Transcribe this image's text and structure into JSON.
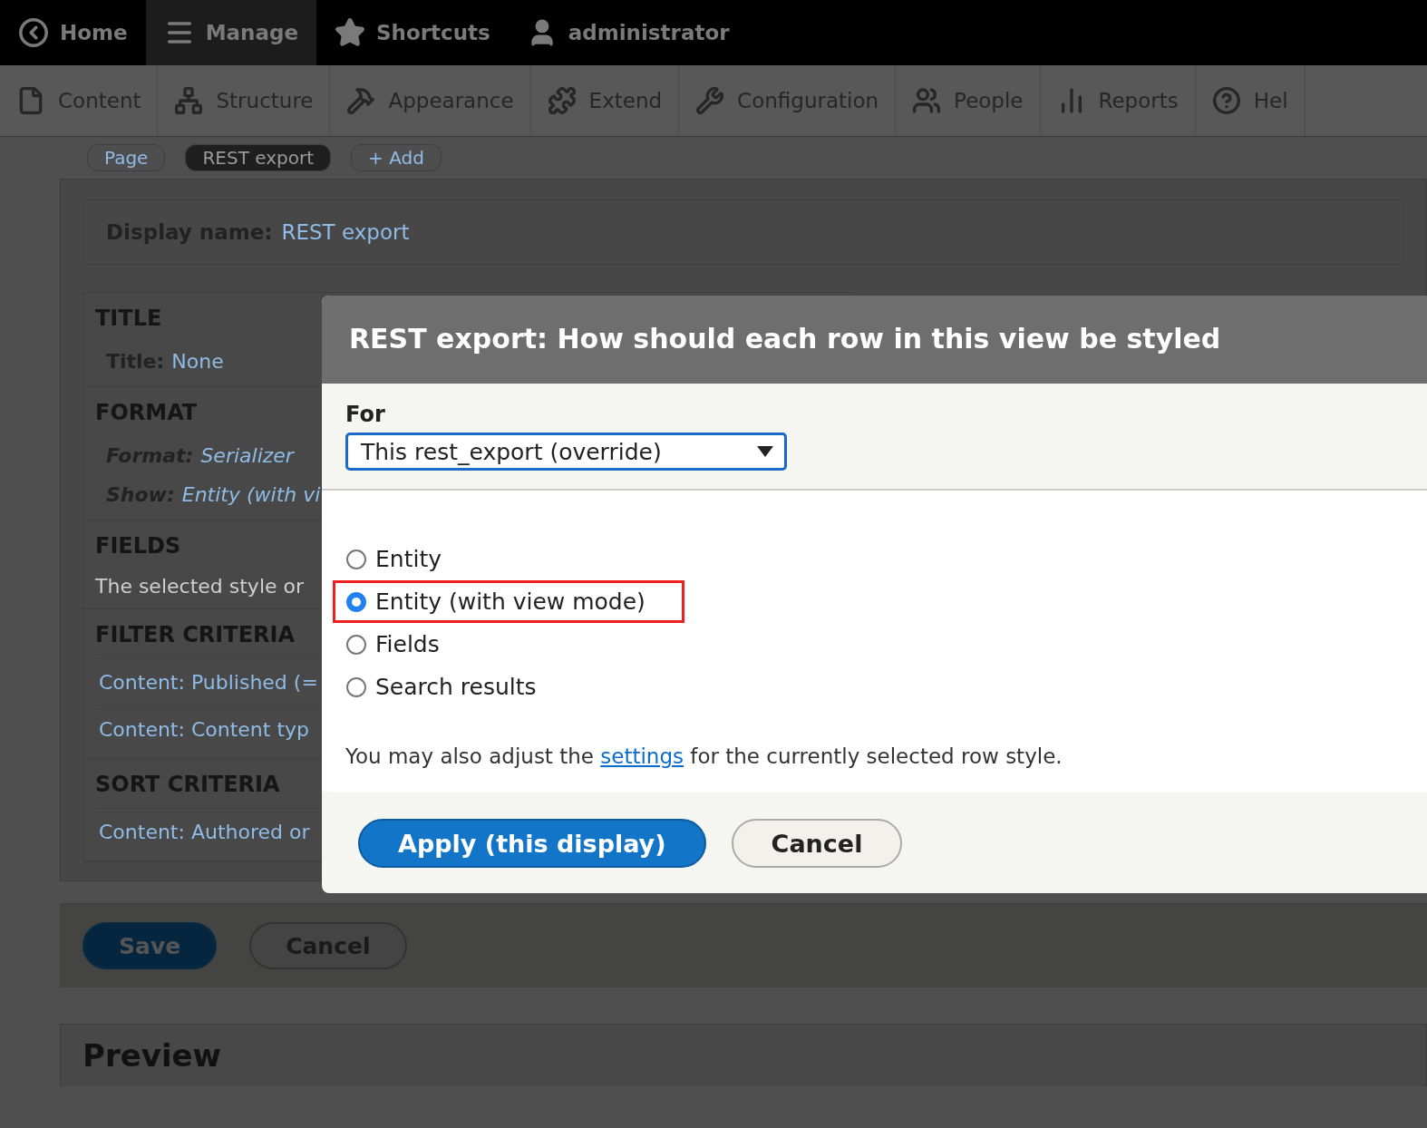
{
  "toolbar": {
    "items": [
      {
        "label": "Home",
        "selected": false
      },
      {
        "label": "Manage",
        "selected": true
      },
      {
        "label": "Shortcuts",
        "selected": false
      },
      {
        "label": "administrator",
        "selected": false
      }
    ]
  },
  "admin_menu": {
    "items": [
      {
        "label": "Content"
      },
      {
        "label": "Structure"
      },
      {
        "label": "Appearance"
      },
      {
        "label": "Extend"
      },
      {
        "label": "Configuration"
      },
      {
        "label": "People"
      },
      {
        "label": "Reports"
      },
      {
        "label": "Hel"
      }
    ]
  },
  "display_tabs": [
    {
      "label": "Page",
      "selected": false
    },
    {
      "label": "REST export",
      "selected": true
    },
    {
      "label": "+ Add",
      "selected": false
    }
  ],
  "display_name": {
    "label": "Display name:",
    "value": "REST export"
  },
  "sections": [
    {
      "heading": "TITLE",
      "rows": [
        {
          "kind": "pair",
          "label": "Title:",
          "value": "None"
        }
      ]
    },
    {
      "heading": "FORMAT",
      "rows": [
        {
          "kind": "italic_pair",
          "label": "Format:",
          "value": "Serializer"
        },
        {
          "kind": "italic_pair",
          "label": "Show:",
          "value": "Entity (with vi"
        }
      ]
    },
    {
      "heading": "FIELDS",
      "rows": [
        {
          "kind": "text",
          "text": "The selected style or"
        }
      ]
    },
    {
      "heading": "FILTER CRITERIA",
      "rows": [
        {
          "kind": "link",
          "text": "Content: Published (="
        },
        {
          "kind": "link",
          "text": "Content: Content typ"
        }
      ]
    },
    {
      "heading": "SORT CRITERIA",
      "rows": [
        {
          "kind": "link",
          "text": "Content: Authored or"
        }
      ]
    }
  ],
  "dialog": {
    "title": "REST export: How should each row in this view be styled",
    "for_label": "For",
    "for_value": "This rest_export (override)",
    "options": [
      {
        "label": "Entity",
        "selected": false,
        "highlighted": false
      },
      {
        "label": "Entity (with view mode)",
        "selected": true,
        "highlighted": true
      },
      {
        "label": "Fields",
        "selected": false,
        "highlighted": false
      },
      {
        "label": "Search results",
        "selected": false,
        "highlighted": false
      }
    ],
    "help_before": "You may also adjust the",
    "help_link": "settings",
    "help_after": "for the currently selected row style.",
    "buttons": [
      {
        "label": "Apply (this display)",
        "kind": "primary"
      },
      {
        "label": "Cancel",
        "kind": "secondary"
      }
    ]
  },
  "form_buttons": [
    {
      "label": "Save",
      "kind": "primary"
    },
    {
      "label": "Cancel",
      "kind": "secondary"
    }
  ],
  "preview": {
    "title": "Preview"
  }
}
